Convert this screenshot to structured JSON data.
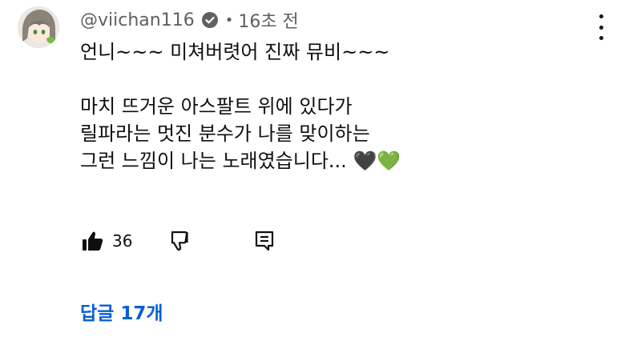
{
  "comment": {
    "author": "@viichan116",
    "time": "16초 전",
    "verified_icon": "verified-check-icon",
    "lines": [
      "언니~~~ 미쳐버렷어 진짜 뮤비~~~",
      "",
      "마치 뜨거운 아스팔트 위에 있다가",
      "릴파라는 멋진 분수가 나를 맞이하는",
      "그런 느낌이 나는 노래였습니다..."
    ],
    "emojis": [
      "🖤",
      "💚"
    ]
  },
  "actions": {
    "like_icon": "thumbs-up-icon",
    "like_count": "36",
    "dislike_icon": "thumbs-down-icon",
    "reply_icon": "reply-comment-icon"
  },
  "replies": {
    "label": "답글 17개"
  },
  "menu": {
    "icon": "more-vertical-icon"
  },
  "colors": {
    "link": "#065fd4",
    "secondary_text": "#606060",
    "primary_text": "#0f0f0f",
    "green_heart": "#7ed321"
  }
}
